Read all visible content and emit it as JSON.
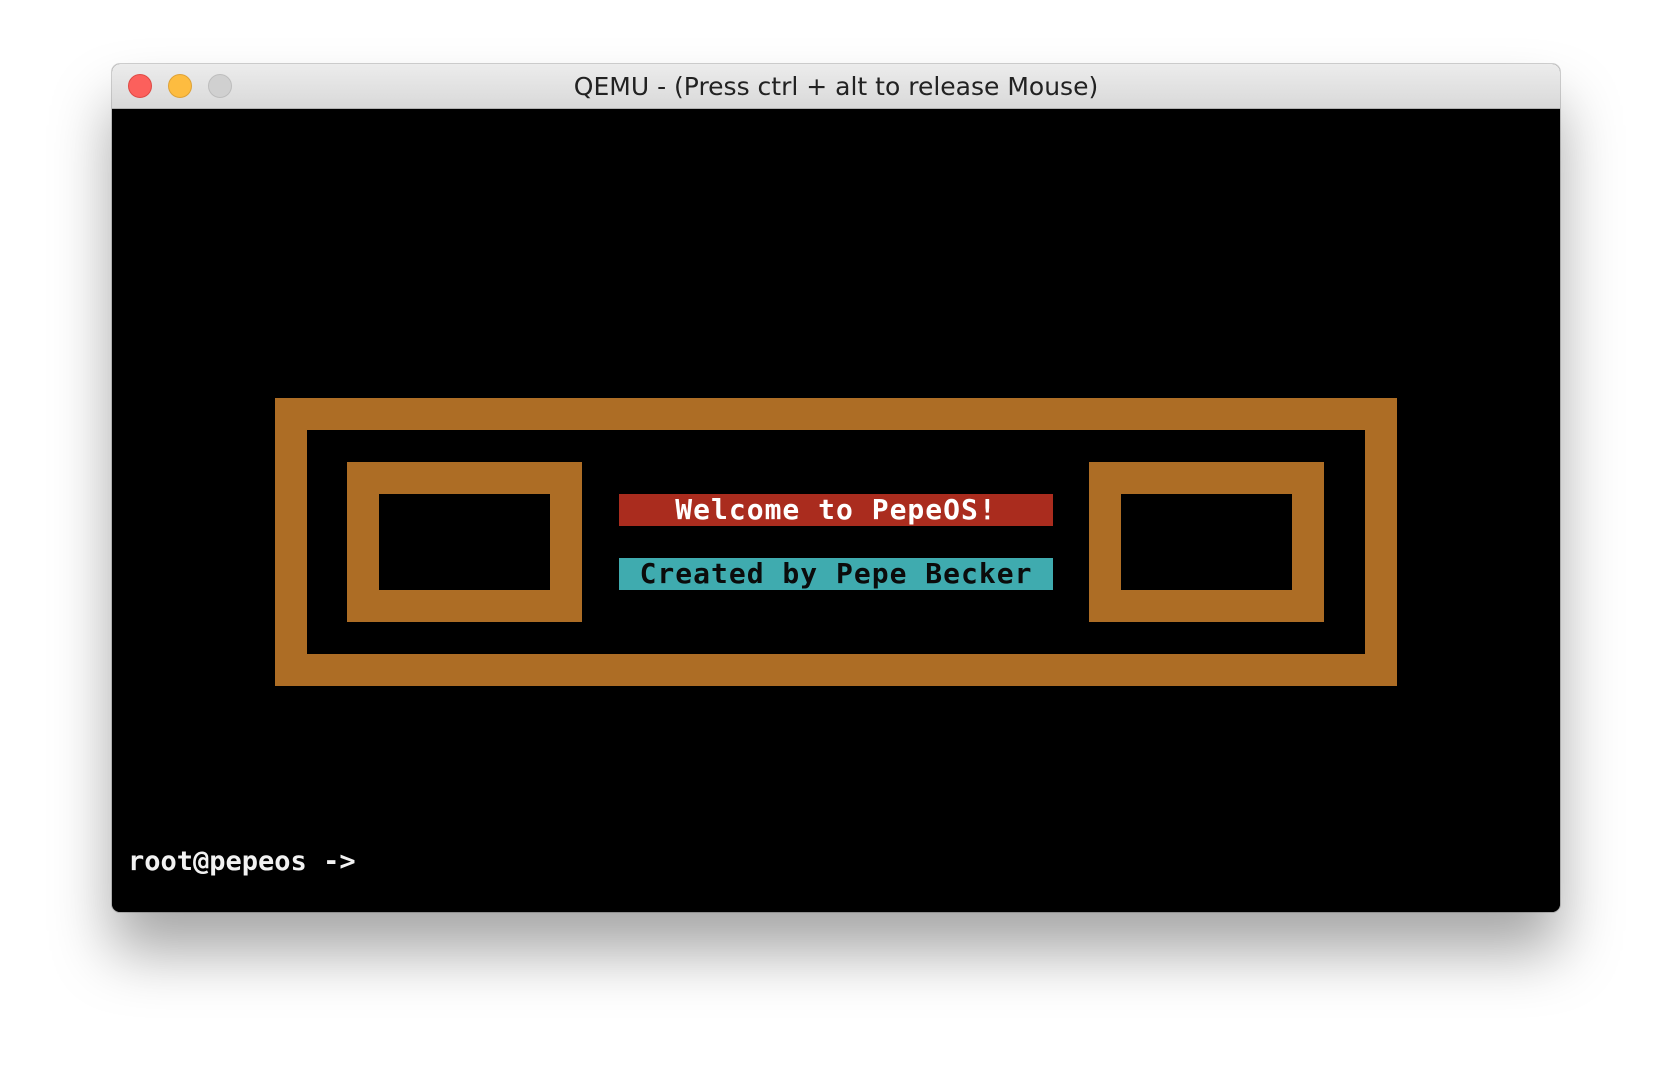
{
  "window": {
    "title": "QEMU - (Press ctrl + alt to release Mouse)"
  },
  "screen": {
    "welcome_text": "Welcome to PepeOS!",
    "created_text": "Created by Pepe Becker",
    "prompt_text": "root@pepeos ->"
  },
  "colors": {
    "frame": "#ad6d25",
    "welcome_bg": "#aa2c1e",
    "created_bg": "#3fabaf",
    "screen_bg": "#000000"
  }
}
